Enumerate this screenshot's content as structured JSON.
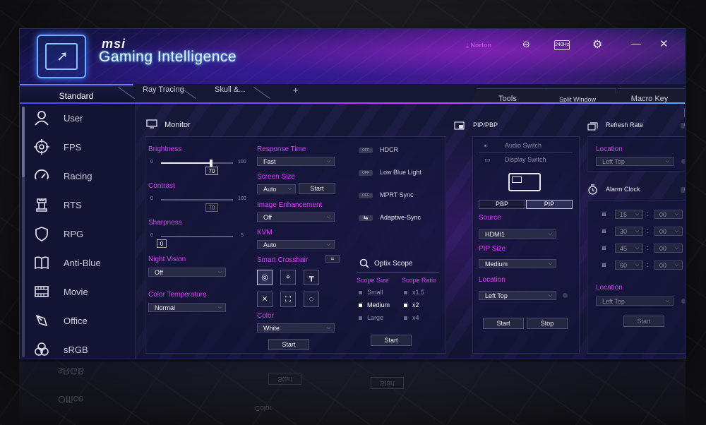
{
  "header": {
    "brand": "msi",
    "product": "Gaming Intelligence",
    "norton_label": "Norton",
    "hz_badge": "240Hz",
    "minimize": "—",
    "close": "✕"
  },
  "tabs": {
    "active": "Standard",
    "others": [
      "Ray Tracing",
      "Skull &..."
    ],
    "add": "+",
    "right": [
      "Tools",
      "Split Window",
      "Macro Key"
    ]
  },
  "sidebar": {
    "items": [
      {
        "label": "User",
        "icon": "user-icon"
      },
      {
        "label": "FPS",
        "icon": "crosshair-icon"
      },
      {
        "label": "Racing",
        "icon": "speedometer-icon"
      },
      {
        "label": "RTS",
        "icon": "chess-rook-icon"
      },
      {
        "label": "RPG",
        "icon": "shield-icon"
      },
      {
        "label": "Anti-Blue",
        "icon": "book-icon"
      },
      {
        "label": "Movie",
        "icon": "film-icon"
      },
      {
        "label": "Office",
        "icon": "pen-icon"
      },
      {
        "label": "sRGB",
        "icon": "rgb-circles-icon"
      }
    ]
  },
  "monitor": {
    "title": "Monitor",
    "brightness": {
      "label": "Brightness",
      "min": "0",
      "max": "100",
      "value": "70",
      "fraction": 0.7
    },
    "contrast": {
      "label": "Contrast",
      "min": "0",
      "max": "100",
      "value": "70",
      "fraction": 0.7
    },
    "sharpness": {
      "label": "Sharpness",
      "min": "0",
      "max": "5",
      "value": "0",
      "fraction": 0
    },
    "night_vision": {
      "label": "Night Vision",
      "value": "Off"
    },
    "color_temperature": {
      "label": "Color Temperature",
      "value": "Normal"
    },
    "response_time": {
      "label": "Response Time",
      "value": "Fast"
    },
    "screen_size": {
      "label": "Screen Size",
      "value": "Auto",
      "button": "Start"
    },
    "image_enhancement": {
      "label": "Image Enhancement",
      "value": "Off"
    },
    "kvm": {
      "label": "KVM",
      "value": "Auto"
    },
    "smart_crosshair": {
      "label": "Smart Crosshair"
    },
    "color": {
      "label": "Color",
      "value": "White",
      "button": "Start"
    },
    "toggles": [
      {
        "label": "HDCR",
        "state": "OFF"
      },
      {
        "label": "Low Blue Light",
        "state": "OFF"
      },
      {
        "label": "MPRT Sync",
        "state": "OFF"
      },
      {
        "label": "Adaptive-Sync",
        "state": ""
      }
    ],
    "optix_scope": {
      "title": "Optix Scope",
      "size_label": "Scope Size",
      "ratio_label": "Scope Ratio",
      "sizes": [
        "Small",
        "Medium",
        "Large"
      ],
      "ratios": [
        "x1.5",
        "x2",
        "x4"
      ],
      "selected_size": "Medium",
      "selected_ratio": "x2",
      "button": "Start"
    }
  },
  "pip": {
    "title": "PIP/PBP",
    "audio_switch": "Audio Switch",
    "display_switch": "Display Switch",
    "modes": [
      "PBP",
      "PIP"
    ],
    "active_mode": "PIP",
    "source_label": "Source",
    "source_value": "HDMI1",
    "size_label": "PIP Size",
    "size_value": "Medium",
    "location_label": "Location",
    "location_value": "Left Top",
    "start": "Start",
    "stop": "Stop"
  },
  "refresh_rate": {
    "title": "Refresh Rate",
    "state": "OFF",
    "location_label": "Location",
    "location_value": "Left Top"
  },
  "alarm_clock": {
    "title": "Alarm Clock",
    "state": "OFF",
    "rows": [
      {
        "min": "15",
        "sec": "00"
      },
      {
        "min": "30",
        "sec": "00"
      },
      {
        "min": "45",
        "sec": "00"
      },
      {
        "min": "60",
        "sec": "00"
      }
    ],
    "location_label": "Location",
    "location_value": "Left Top",
    "start": "Start"
  },
  "reflection": {
    "items": [
      "sRGB",
      "Office"
    ],
    "buttons": [
      "Start",
      "Start"
    ],
    "color": "Color"
  },
  "colors": {
    "accent": "#e03cff",
    "bg": "#151735",
    "logo_glow": "#3f7dff"
  }
}
